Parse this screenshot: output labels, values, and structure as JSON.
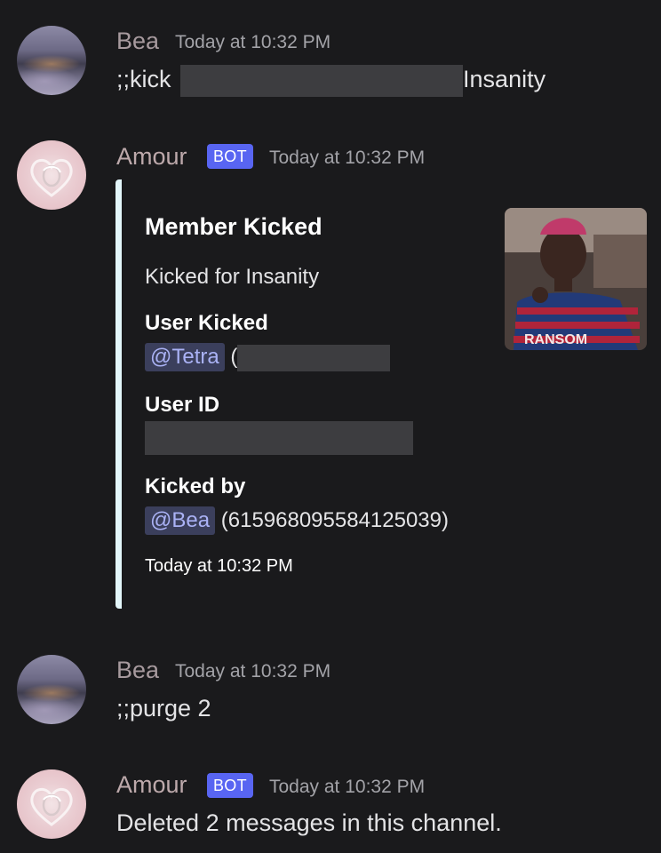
{
  "messages": [
    {
      "author": "Bea",
      "timestamp": "Today at 10:32 PM",
      "content_prefix": ";;kick",
      "content_suffix": "Insanity"
    },
    {
      "author": "Amour",
      "bot_tag": "BOT",
      "timestamp": "Today at 10:32 PM",
      "embed": {
        "title": "Member Kicked",
        "description": "Kicked for Insanity",
        "fields": [
          {
            "name": "User Kicked",
            "mention": "@Tetra",
            "after": "("
          },
          {
            "name": "User ID"
          },
          {
            "name": "Kicked by",
            "mention": "@Bea",
            "after": "(615968095584125039)"
          }
        ],
        "footer": "Today at 10:32 PM",
        "thumbnail_text": "RANSOM"
      }
    },
    {
      "author": "Bea",
      "timestamp": "Today at 10:32 PM",
      "content": ";;purge 2"
    },
    {
      "author": "Amour",
      "bot_tag": "BOT",
      "timestamp": "Today at 10:32 PM",
      "content": "Deleted 2 messages in this channel."
    }
  ],
  "colors": {
    "background": "#1a1a1c",
    "bot_tag": "#5865f2",
    "mention_text": "#aab2f5",
    "embed_bar": "#e3f6fa"
  },
  "icons": {
    "avatar_bea": "landscape-avatar",
    "avatar_amour": "heart-avatar"
  }
}
